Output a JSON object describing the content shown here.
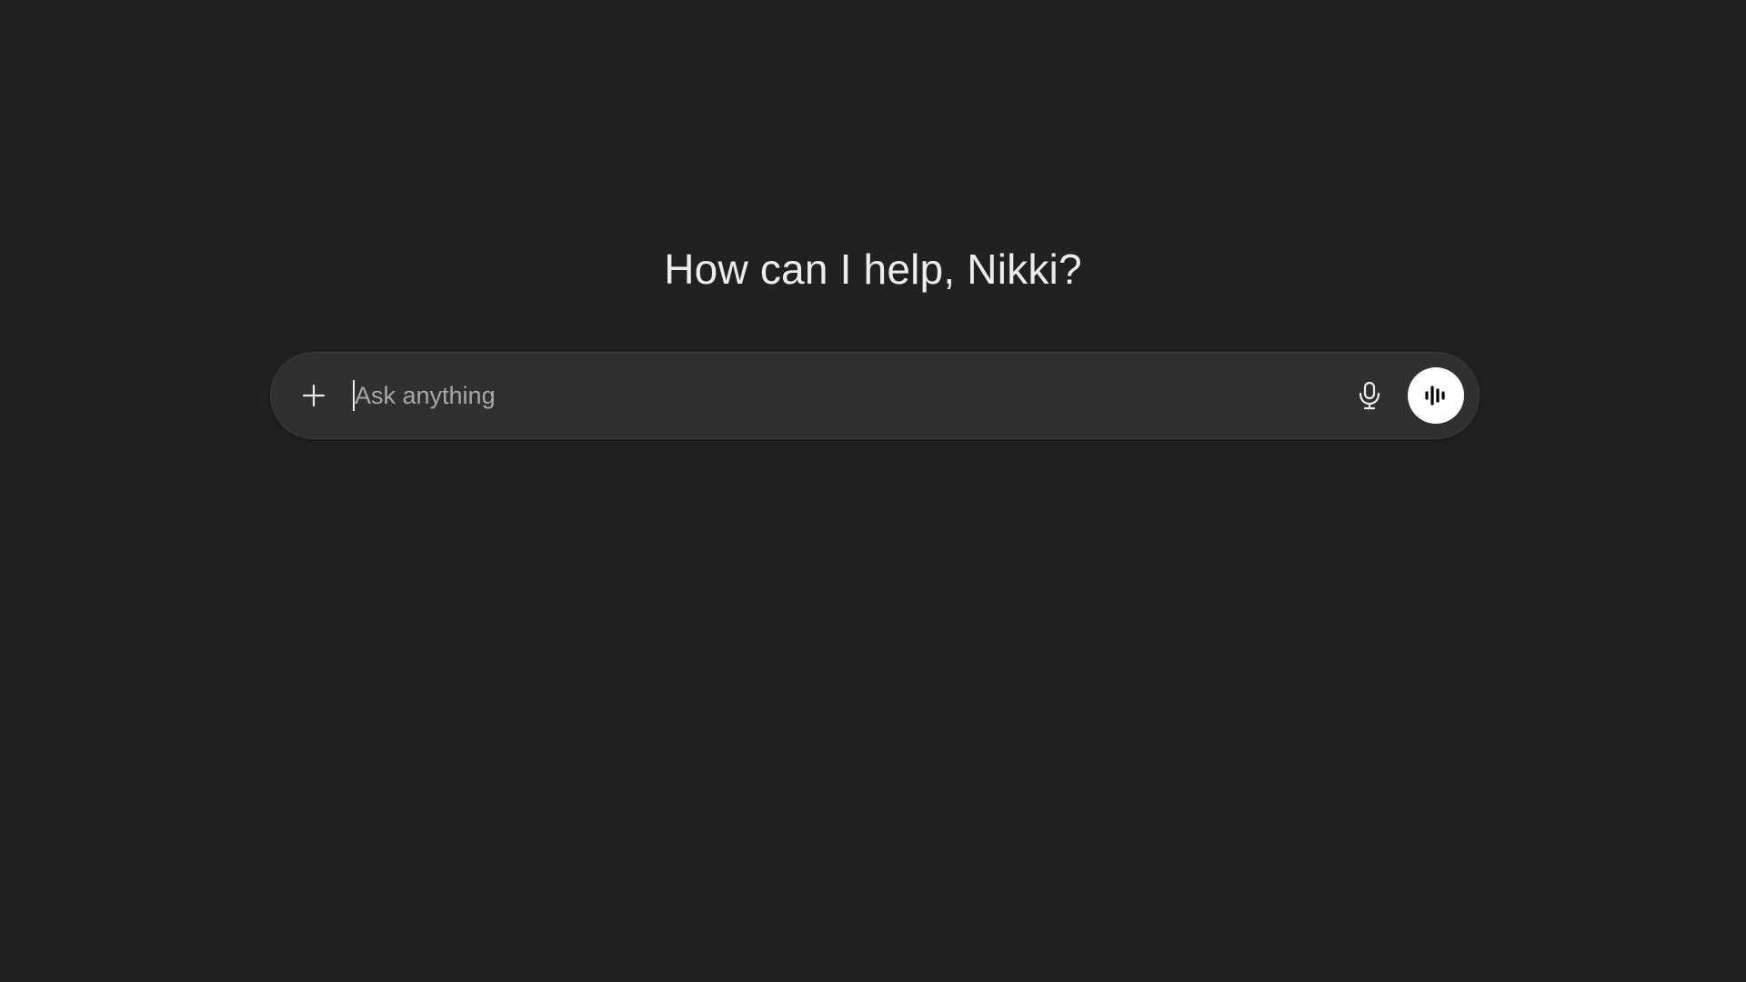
{
  "main": {
    "greeting": "How can I help, Nikki?"
  },
  "composer": {
    "placeholder": "Ask anything",
    "value": "",
    "icons": {
      "add": "plus-icon",
      "dictate": "microphone-icon",
      "voice_mode": "voice-waveform-icon"
    }
  },
  "colors": {
    "background": "#212121",
    "composer": "#303030",
    "text": "#ececec",
    "placeholder": "#a8a8a8",
    "voice_button": "#ffffff"
  }
}
